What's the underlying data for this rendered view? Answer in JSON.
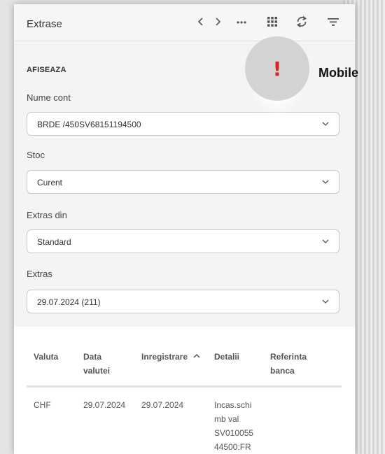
{
  "header": {
    "title": "Extrase",
    "icons": [
      "chevron-left-icon",
      "chevron-right-icon",
      "more-icon",
      "grid-icon",
      "refresh-icon",
      "filter-icon"
    ],
    "prev_glyph": "‹",
    "next_glyph": "›",
    "more_glyph": "···"
  },
  "form": {
    "section_title": "AFISEAZA",
    "fields": [
      {
        "label": "Nume cont",
        "value": "BRDE /450SV68151194500"
      },
      {
        "label": "Stoc",
        "value": "Curent"
      },
      {
        "label": "Extras din",
        "value": "Standard"
      },
      {
        "label": "Extras",
        "value": "29.07.2024 (211)"
      }
    ]
  },
  "table": {
    "columns": [
      {
        "line1": "Valuta",
        "line2": ""
      },
      {
        "line1": "Data",
        "line2": "valutei"
      },
      {
        "line1": "Inregistrare",
        "line2": ""
      },
      {
        "line1": "Detalii",
        "line2": ""
      },
      {
        "line1": "Referinta",
        "line2": "banca"
      }
    ],
    "sort_indicator": "^",
    "rows": [
      {
        "valuta": "CHF",
        "data_valutei": "29.07.2024",
        "inregistrare": "29.07.2024",
        "detalii": [
          "Incas.schi",
          "mb val",
          "SV010055",
          "44500:FR"
        ],
        "referinta": ""
      }
    ]
  },
  "overlay": {
    "mark": "!",
    "label": "Mobile",
    "mark_color": "#e02020"
  },
  "colors": {
    "panel_bg": "#ffffff",
    "form_bg": "#f4f4f4",
    "header_bg": "#f6f6f6",
    "badge_circle": "#d3d3d3"
  }
}
